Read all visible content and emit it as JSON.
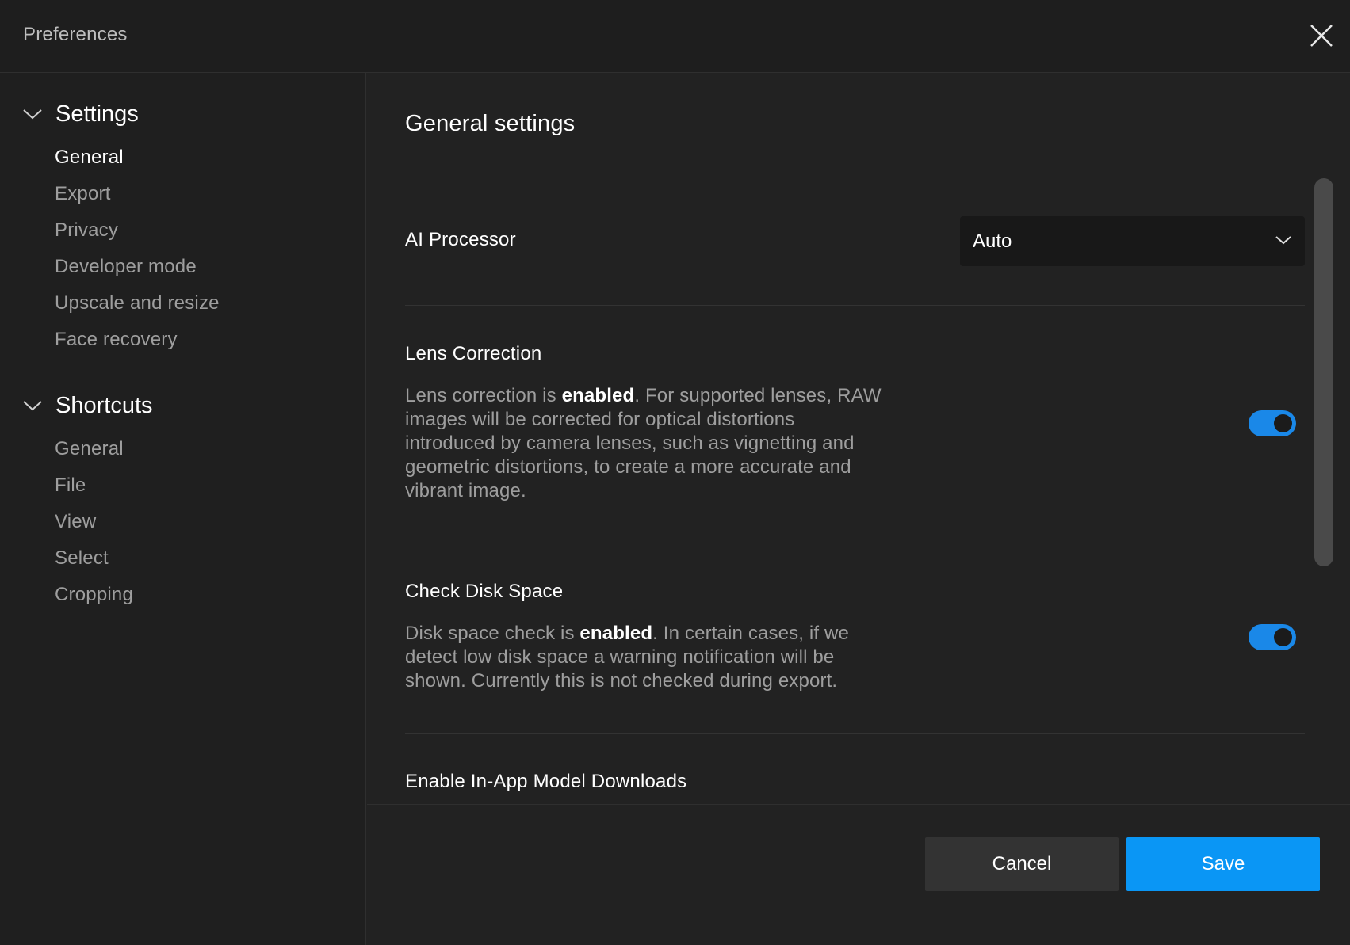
{
  "window": {
    "title": "Preferences"
  },
  "sidebar": {
    "sections": [
      {
        "title": "Settings",
        "items": [
          "General",
          "Export",
          "Privacy",
          "Developer mode",
          "Upscale and resize",
          "Face recovery"
        ]
      },
      {
        "title": "Shortcuts",
        "items": [
          "General",
          "File",
          "View",
          "Select",
          "Cropping"
        ]
      }
    ],
    "active_item": "Settings/General"
  },
  "main": {
    "title": "General settings",
    "ai_processor": {
      "label": "AI Processor",
      "value": "Auto"
    },
    "lens_correction": {
      "label": "Lens Correction",
      "desc_prefix": "Lens correction is ",
      "desc_state": "enabled",
      "desc_suffix": ". For supported lenses, RAW images will be corrected for optical distortions introduced by camera lenses, such as vignetting and geometric distortions, to create a more accurate and vibrant image.",
      "enabled": true
    },
    "check_disk_space": {
      "label": "Check Disk Space",
      "desc_prefix": "Disk space check is ",
      "desc_state": "enabled",
      "desc_suffix": ". In certain cases, if we detect low disk space a warning notification will be shown. Currently this is not checked during export.",
      "enabled": true
    },
    "model_downloads": {
      "label": "Enable In-App Model Downloads"
    }
  },
  "footer": {
    "cancel_label": "Cancel",
    "save_label": "Save"
  },
  "colors": {
    "accent": "#0a96f5",
    "toggle_on": "#1a88e8",
    "background": "#222222"
  },
  "icons": {
    "close": "close-icon",
    "section_chevron": "chevron-down-icon",
    "select_chevron": "chevron-down-icon"
  }
}
